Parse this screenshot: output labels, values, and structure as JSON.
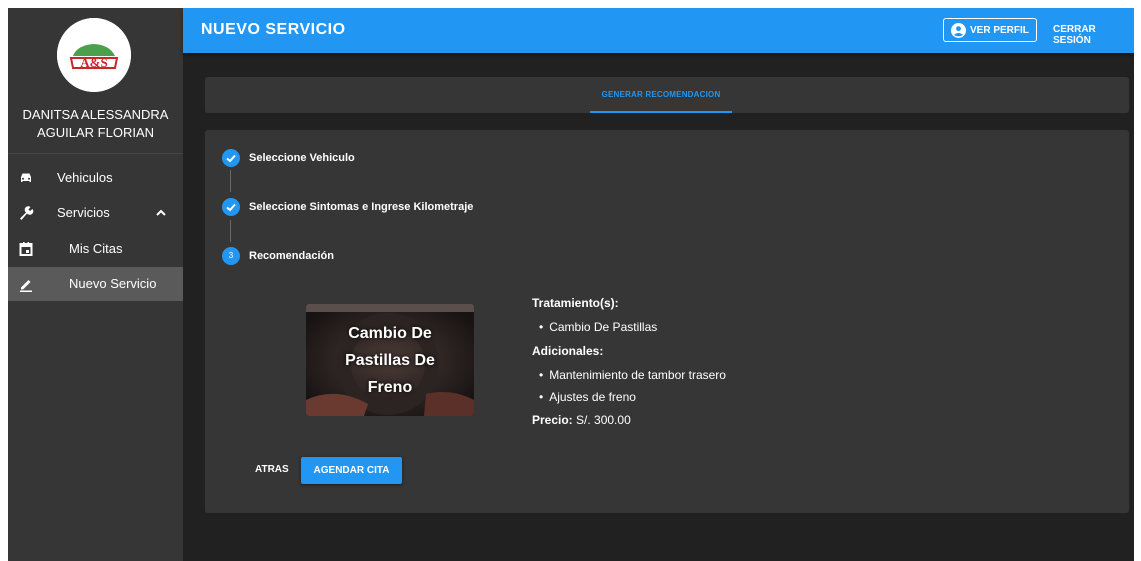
{
  "sidebar": {
    "logo_text": "A&S",
    "user_name_line1": "DANITSA ALESSANDRA",
    "user_name_line2": "AGUILAR FLORIAN",
    "items": [
      {
        "label": "Vehiculos",
        "icon": "car-icon"
      },
      {
        "label": "Servicios",
        "icon": "wrench-icon",
        "expanded": true
      },
      {
        "label": "Mis Citas",
        "icon": "calendar-icon"
      },
      {
        "label": "Nuevo Servicio",
        "icon": "pencil-icon",
        "active": true
      }
    ]
  },
  "header": {
    "title": "NUEVO SERVICIO",
    "profile_label": "VER PERFIL",
    "logout_label": "CERRAR SESIÓN"
  },
  "tabs": {
    "active_label": "GENERAR RECOMENDACION"
  },
  "stepper": {
    "steps": [
      {
        "label": "Seleccione Vehiculo",
        "status": "complete"
      },
      {
        "label": "Seleccione Sintomas e Ingrese Kilometraje",
        "status": "complete"
      },
      {
        "label": "Recomendación",
        "status": "active",
        "number": "3"
      }
    ]
  },
  "recommendation": {
    "image_caption_line1": "Cambio De",
    "image_caption_line2": "Pastillas De",
    "image_caption_line3": "Freno",
    "treatments_label": "Tratamiento(s):",
    "treatments": [
      "Cambio De Pastillas"
    ],
    "extras_label": "Adicionales:",
    "extras": [
      "Mantenimiento de tambor trasero",
      "Ajustes de freno"
    ],
    "price_label": "Precio:",
    "price_value": "S/. 300.00"
  },
  "actions": {
    "back_label": "ATRAS",
    "schedule_label": "AGENDAR CITA"
  },
  "colors": {
    "primary": "#2196f3",
    "sidebar_bg": "#363636",
    "content_bg": "#212121",
    "card_bg": "#363636"
  }
}
